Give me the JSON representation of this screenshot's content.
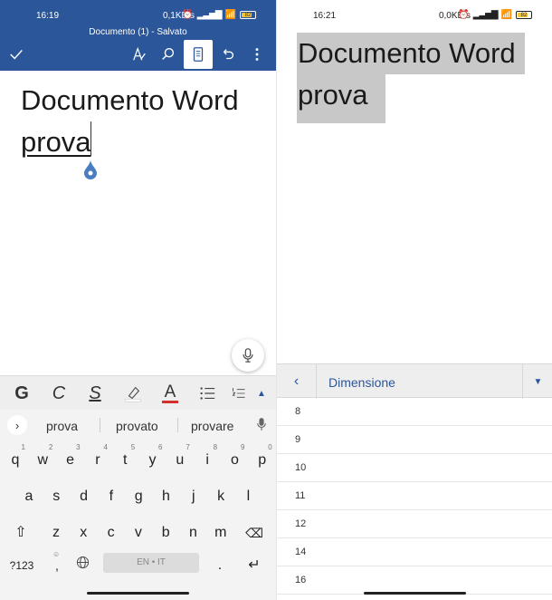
{
  "left": {
    "status": {
      "time": "16:19",
      "speed": "0,1KB/s",
      "battery": "82"
    },
    "doc_title": "Documento (1) - Salvato",
    "document": {
      "line1": "Documento Word",
      "line2": "prova"
    },
    "format_bar": {
      "bold": "G",
      "italic": "C",
      "underline": "S",
      "font_color": "A"
    },
    "suggestions": [
      "prova",
      "provato",
      "provare"
    ],
    "keyboard": {
      "row1": [
        [
          "q",
          "1"
        ],
        [
          "w",
          "2"
        ],
        [
          "e",
          "3"
        ],
        [
          "r",
          "4"
        ],
        [
          "t",
          "5"
        ],
        [
          "y",
          "6"
        ],
        [
          "u",
          "7"
        ],
        [
          "i",
          "8"
        ],
        [
          "o",
          "9"
        ],
        [
          "p",
          "0"
        ]
      ],
      "row2": [
        "a",
        "s",
        "d",
        "f",
        "g",
        "h",
        "j",
        "k",
        "l"
      ],
      "row3": [
        "z",
        "x",
        "c",
        "v",
        "b",
        "n",
        "m"
      ],
      "symbols_label": "?123",
      "space_label": "EN • IT",
      "period": "."
    }
  },
  "right": {
    "status": {
      "time": "16:21",
      "speed": "0,0KB/s",
      "battery": "82"
    },
    "selected_text": {
      "line1": "Documento Word",
      "line2": "prova"
    },
    "dimension_label": "Dimensione",
    "sizes": [
      "8",
      "9",
      "10",
      "11",
      "12",
      "14",
      "16"
    ]
  },
  "colors": {
    "word_blue": "#2b579a",
    "selection": "#c8c8c8",
    "font_color_underline": "#d32f2f"
  }
}
